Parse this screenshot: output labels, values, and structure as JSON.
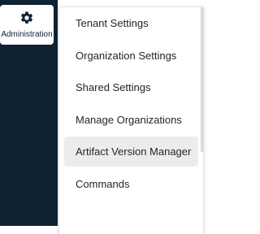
{
  "sidebar": {
    "admin_label": "Administration",
    "admin_icon": "gear-icon"
  },
  "menu": {
    "items": [
      {
        "label": "Tenant Settings"
      },
      {
        "label": "Organization Settings"
      },
      {
        "label": "Shared Settings"
      },
      {
        "label": "Manage Organizations"
      },
      {
        "label": "Artifact Version Manager",
        "active": true
      },
      {
        "label": "Commands"
      }
    ]
  },
  "colors": {
    "sidebar_bg": "#0f2233",
    "active_item_bg": "#ececec"
  }
}
